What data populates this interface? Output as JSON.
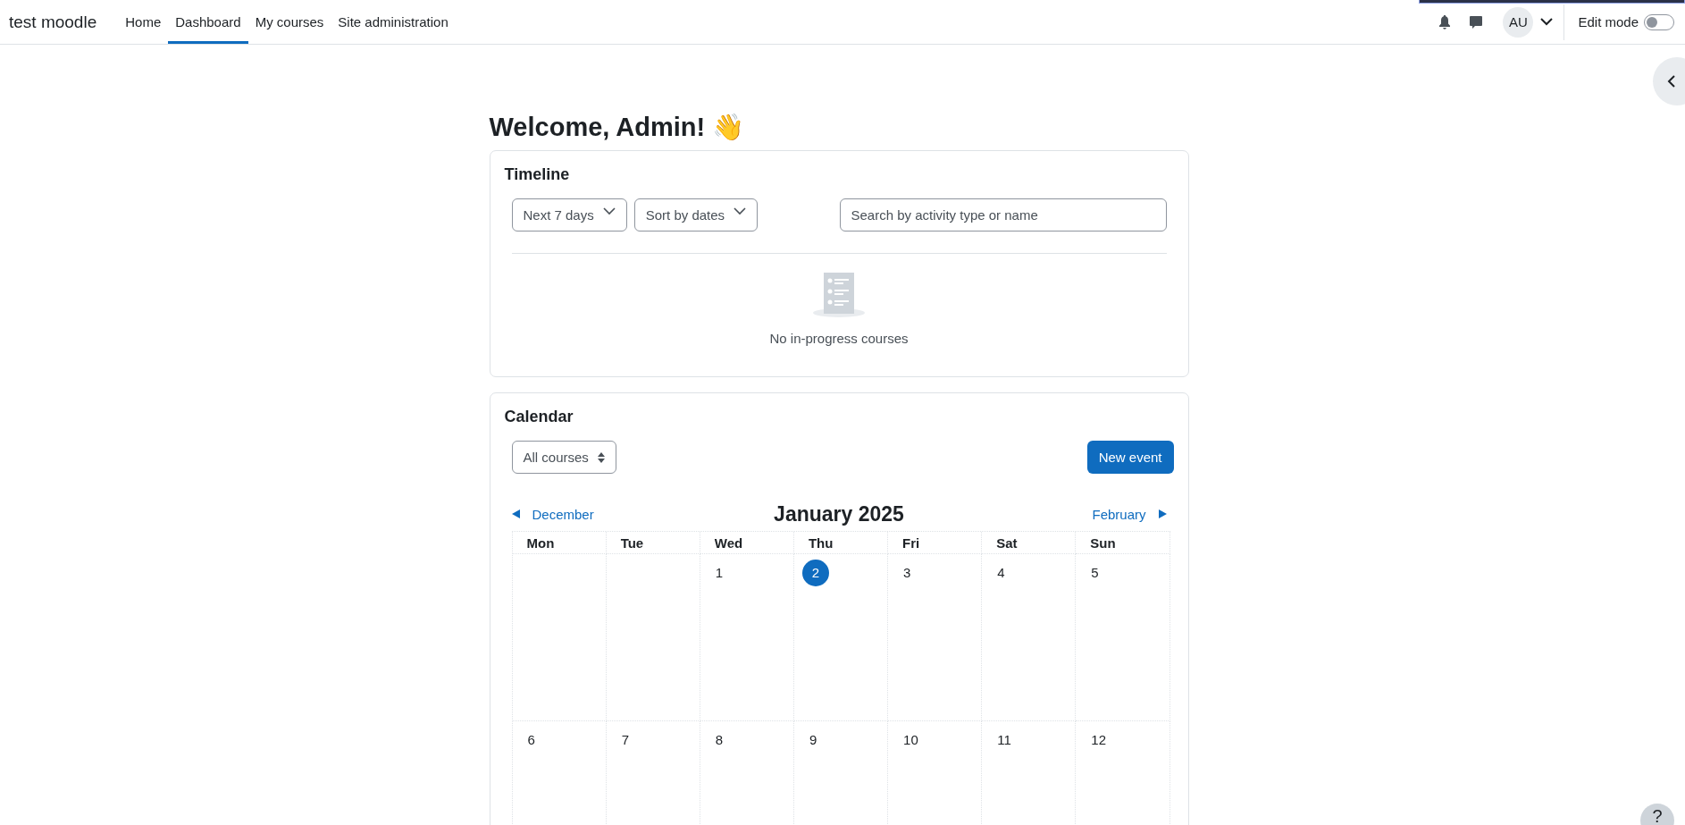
{
  "site_name": "test moodle",
  "nav": [
    {
      "label": "Home",
      "selected": false
    },
    {
      "label": "Dashboard",
      "selected": true
    },
    {
      "label": "My courses",
      "selected": false
    },
    {
      "label": "Site administration",
      "selected": false
    }
  ],
  "user": {
    "initials": "AU"
  },
  "edit_mode": {
    "label": "Edit mode",
    "on": false
  },
  "welcome": "Welcome, Admin! 👋",
  "timeline": {
    "title": "Timeline",
    "filters": [
      "Next 7 days",
      "Sort by dates"
    ],
    "search": {
      "placeholder": "Search by activity type or name"
    },
    "empty_message": "No in-progress courses"
  },
  "calendar": {
    "title": "Calendar",
    "course_filter": "All courses",
    "new_event": "New event",
    "prev_month": "December",
    "month": "January 2025",
    "next_month": "February",
    "weekdays": [
      "Mon",
      "Tue",
      "Wed",
      "Thu",
      "Fri",
      "Sat",
      "Sun"
    ],
    "weeks": [
      [
        {
          "kind": "blank"
        },
        {
          "kind": "blank"
        },
        {
          "kind": "day",
          "day": "1",
          "today": false
        },
        {
          "kind": "day",
          "day": "2",
          "today": true
        },
        {
          "kind": "day",
          "day": "3",
          "today": false
        },
        {
          "kind": "day",
          "day": "4",
          "today": false
        },
        {
          "kind": "day",
          "day": "5",
          "today": false
        }
      ],
      [
        {
          "kind": "day",
          "day": "6",
          "today": false
        },
        {
          "kind": "day",
          "day": "7",
          "today": false
        },
        {
          "kind": "day",
          "day": "8",
          "today": false
        },
        {
          "kind": "day",
          "day": "9",
          "today": false
        },
        {
          "kind": "day",
          "day": "10",
          "today": false
        },
        {
          "kind": "day",
          "day": "11",
          "today": false
        },
        {
          "kind": "day",
          "day": "12",
          "today": false
        }
      ]
    ]
  },
  "help": "?"
}
